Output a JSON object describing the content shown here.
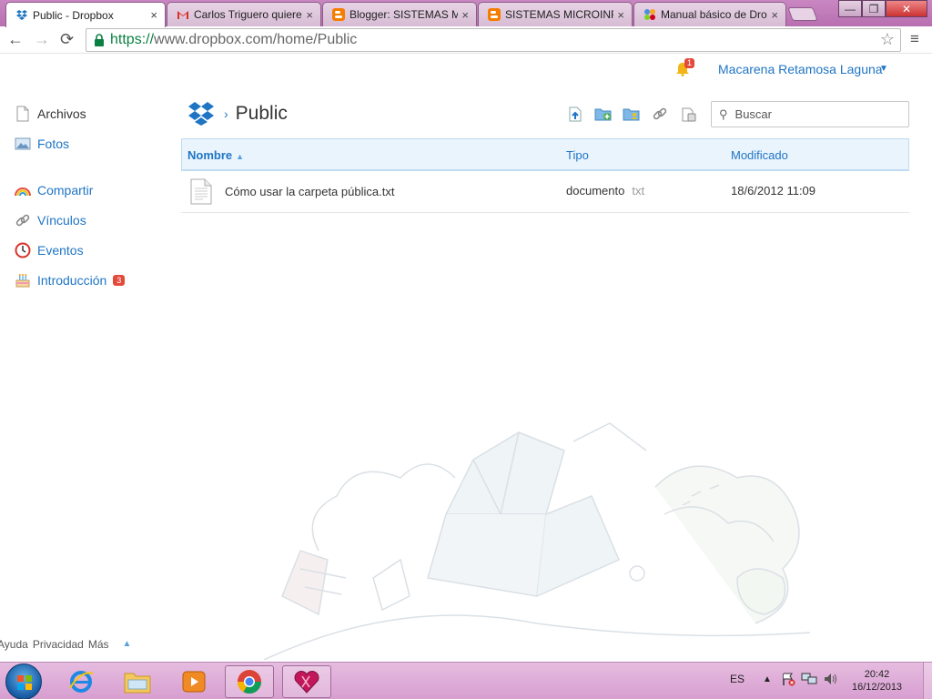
{
  "browser": {
    "tabs": [
      {
        "title": "Public - Dropbox",
        "icon": "dropbox-favicon",
        "active": true
      },
      {
        "title": "Carlos Triguero quiere",
        "icon": "gmail-favicon",
        "active": false
      },
      {
        "title": "Blogger: SISTEMAS MI",
        "icon": "blogger-favicon",
        "active": false
      },
      {
        "title": "SISTEMAS MICROINFO",
        "icon": "blogger-favicon",
        "active": false
      },
      {
        "title": "Manual básico de Drop",
        "icon": "page-favicon",
        "active": false
      }
    ],
    "tab_close": "×",
    "url_scheme": "https://",
    "url_rest": "www.dropbox.com/home/Public",
    "window_buttons": {
      "minimize": "—",
      "maximize": "❐",
      "close": "✕"
    }
  },
  "header": {
    "notification_count": "1",
    "user_name": "Macarena Retamosa Laguna"
  },
  "sidebar": {
    "items": [
      {
        "label": "Archivos",
        "icon": "files-icon"
      },
      {
        "label": "Fotos",
        "icon": "photos-icon"
      },
      {
        "label": "Compartir",
        "icon": "share-rainbow-icon"
      },
      {
        "label": "Vínculos",
        "icon": "links-icon"
      },
      {
        "label": "Eventos",
        "icon": "events-clock-icon"
      },
      {
        "label": "Introducción",
        "icon": "cake-icon",
        "count": "3"
      }
    ]
  },
  "main": {
    "folder_title": "Public",
    "search_placeholder": "Buscar",
    "columns": {
      "name": "Nombre",
      "type": "Tipo",
      "modified": "Modificado"
    },
    "files": [
      {
        "name": "Cómo usar la carpeta pública.txt",
        "type": "documento",
        "ext": "txt",
        "modified": "18/6/2012 11:09"
      }
    ]
  },
  "footer": {
    "links": [
      "Ayuda",
      "Privacidad",
      "Más"
    ]
  },
  "taskbar": {
    "language": "ES",
    "time": "20:42",
    "date": "16/12/2013"
  },
  "colors": {
    "link_blue": "#1f75c4",
    "header_bg": "#eaf4fd",
    "badge_red": "#e34a3c",
    "chrome_frame": "#c987c2",
    "taskbar": "#e6bce0"
  }
}
